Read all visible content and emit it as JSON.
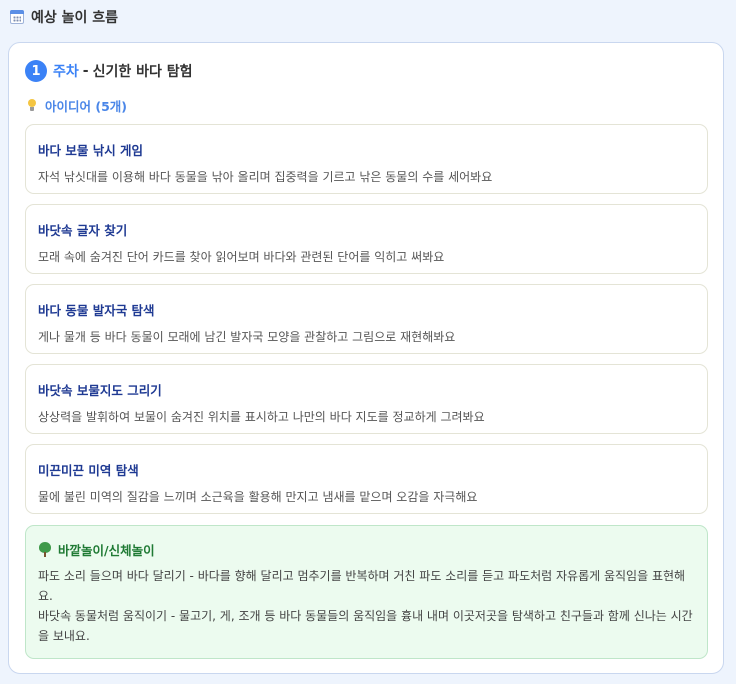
{
  "header": {
    "title": "예상 놀이 흐름",
    "icon": "calendar-icon"
  },
  "week": {
    "number": "1",
    "label": "주차",
    "separator": "-",
    "theme": "신기한 바다 탐험",
    "accent_color": "#3b82f6"
  },
  "ideas": {
    "label": "아이디어 (5개)",
    "icon": "lightbulb-icon",
    "items": [
      {
        "title": "바다 보물 낚시 게임",
        "description": "자석 낚싯대를 이용해 바다 동물을 낚아 올리며 집중력을 기르고 낚은 동물의 수를 세어봐요"
      },
      {
        "title": "바닷속 글자 찾기",
        "description": "모래 속에 숨겨진 단어 카드를 찾아 읽어보며 바다와 관련된 단어를 익히고 써봐요"
      },
      {
        "title": "바다 동물 발자국 탐색",
        "description": "게나 물개 등 바다 동물이 모래에 남긴 발자국 모양을 관찰하고 그림으로 재현해봐요"
      },
      {
        "title": "바닷속 보물지도 그리기",
        "description": "상상력을 발휘하여 보물이 숨겨진 위치를 표시하고 나만의 바다 지도를 정교하게 그려봐요"
      },
      {
        "title": "미끈미끈 미역 탐색",
        "description": "물에 불린 미역의 질감을 느끼며 소근육을 활용해 만지고 냄새를 맡으며 오감을 자극해요"
      }
    ]
  },
  "outdoor": {
    "title": "바깥놀이/신체놀이",
    "icon": "tree-icon",
    "lines": [
      "파도 소리 들으며 바다 달리기 - 바다를 향해 달리고 멈추기를 반복하며 거친 파도 소리를 듣고 파도처럼 자유롭게 움직임을 표현해요.",
      "바닷속 동물처럼 움직이기 - 물고기, 게, 조개 등 바다 동물들의 움직임을 흉내 내며 이곳저곳을 탐색하고 친구들과 함께 신나는 시간을 보내요."
    ],
    "color": "#1f7a34"
  }
}
